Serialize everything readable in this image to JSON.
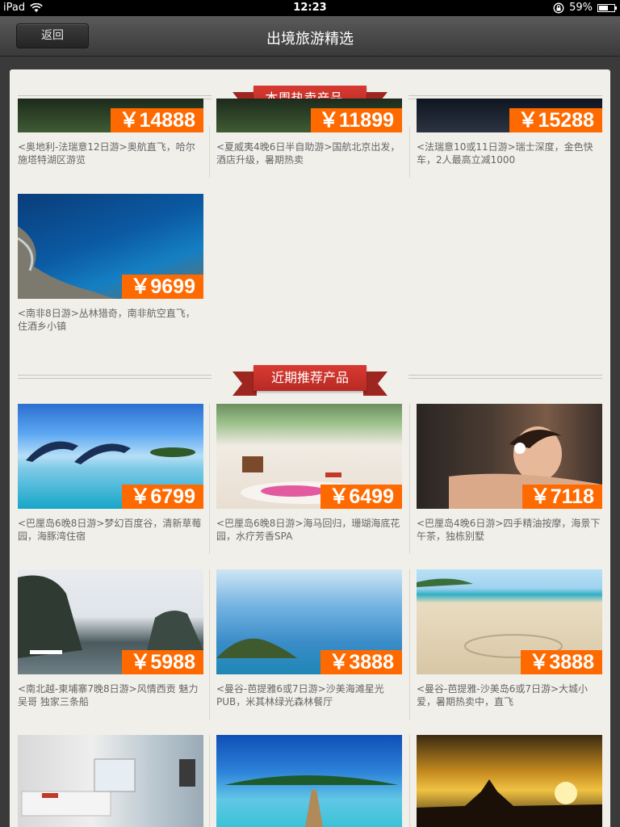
{
  "status_bar": {
    "device": "iPad",
    "time": "12:23",
    "battery": "59%",
    "battery_level": 0.59
  },
  "nav": {
    "back_label": "返回",
    "title": "出境旅游精选"
  },
  "sections": {
    "hot": "本周热卖产品...",
    "recommended": "近期推荐产品"
  },
  "hot_products": [
    {
      "price": "￥14888",
      "desc": "<奥地利-法瑞意12日游>奥航直飞，哈尔施塔特湖区游览"
    },
    {
      "price": "￥11899",
      "desc": "<夏威夷4晚6日半自助游>国航北京出发，酒店升级，暑期热卖"
    },
    {
      "price": "￥15288",
      "desc": "<法瑞意10或11日游>瑞士深度，金色快车，2人最高立减1000"
    },
    {
      "price": "￥9699",
      "desc": "<南非8日游>丛林猎奇，南非航空直飞，住酒乡小镇"
    }
  ],
  "recommended_products": [
    {
      "price": "￥6799",
      "desc": "<巴厘岛6晚8日游>梦幻百度谷，清新草莓园，海豚湾住宿"
    },
    {
      "price": "￥6499",
      "desc": "<巴厘岛6晚8日游>海马回归，珊瑚海底花园，水疗芳香SPA"
    },
    {
      "price": "￥7118",
      "desc": "<巴厘岛4晚6日游>四手精油按摩，海景下午茶，独栋别墅"
    },
    {
      "price": "￥5988",
      "desc": "<南北越-柬埔寨7晚8日游>风情西贡 魅力吴哥 独家三条船"
    },
    {
      "price": "￥3888",
      "desc": "<曼谷-芭提雅6或7日游>沙美海滩星光PUB，米其林绿光森林餐厅"
    },
    {
      "price": "￥3888",
      "desc": "<曼谷-芭提雅-沙美岛6或7日游>大城小爱，暑期热卖中，直飞"
    }
  ],
  "colors": {
    "price_bg": "#ff6a00",
    "ribbon": "#c8302a",
    "content_bg": "#f1efea"
  },
  "icons": [
    "wifi-icon",
    "lock-rotation-icon",
    "battery-icon"
  ]
}
